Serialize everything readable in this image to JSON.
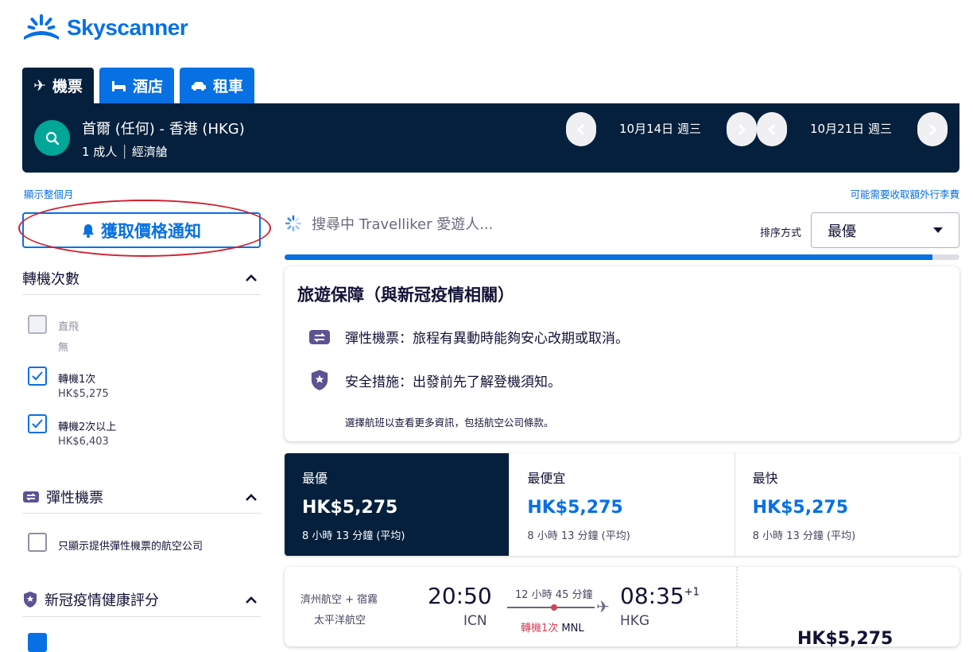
{
  "brand": {
    "name": "Skyscanner",
    "color": "#0770e3"
  },
  "tabs": [
    {
      "label": "機票",
      "icon": "plane-icon"
    },
    {
      "label": "酒店",
      "icon": "bed-icon"
    },
    {
      "label": "租車",
      "icon": "car-icon"
    }
  ],
  "search": {
    "route": "首爾 (任何) - 香港 (HKG)",
    "passengers": "1 成人",
    "cabin": "經濟艙",
    "depart_date": "10月14日 週三",
    "return_date": "10月21日 週三"
  },
  "links": {
    "show_month": "顯示整個月",
    "baggage_fees": "可能需要收取額外行李費"
  },
  "price_alert": {
    "label": "獲取價格通知"
  },
  "filters": {
    "stops": {
      "title": "轉機次數",
      "options": [
        {
          "label": "直飛",
          "sub": "無",
          "checked": false,
          "disabled": true
        },
        {
          "label": "轉機1次",
          "sub": "HK$5,275",
          "checked": true
        },
        {
          "label": "轉機2次以上",
          "sub": "HK$6,403",
          "checked": true
        }
      ]
    },
    "flexible": {
      "title": "彈性機票",
      "option": "只顯示提供彈性機票的航空公司"
    },
    "covid": {
      "title": "新冠疫情健康評分"
    }
  },
  "status": {
    "searching": "搜尋中 Travelliker 愛遊人...",
    "progress": 0.96
  },
  "sort": {
    "label": "排序方式",
    "value": "最優"
  },
  "info_card": {
    "title": "旅遊保障（與新冠疫情相關）",
    "items": [
      {
        "icon": "flexible-ticket-icon",
        "text": "彈性機票：旅程有異動時能夠安心改期或取消。"
      },
      {
        "icon": "shield-icon",
        "text": "安全措施：出發前先了解登機須知。"
      }
    ],
    "note": "選擇航班以查看更多資訊，包括航空公司條款。"
  },
  "sort_options": [
    {
      "name": "最優",
      "price": "HK$5,275",
      "duration": "8 小時 13 分鐘 (平均)",
      "active": true
    },
    {
      "name": "最便宜",
      "price": "HK$5,275",
      "duration": "8 小時 13 分鐘 (平均)",
      "active": false
    },
    {
      "name": "最快",
      "price": "HK$5,275",
      "duration": "8 小時 13 分鐘 (平均)",
      "active": false
    }
  ],
  "flight": {
    "airline_line1": "濟州航空 + 宿霧",
    "airline_line2": "太平洋航空",
    "depart_time": "20:50",
    "depart_code": "ICN",
    "duration": "12 小時 45 分鐘",
    "stops": "轉機1次",
    "via": "MNL",
    "arrive_time": "08:35",
    "day_offset": "+1",
    "arrive_code": "HKG",
    "price": "HK$5,275"
  },
  "colors": {
    "navy": "#05203c",
    "blue": "#0770e3",
    "teal": "#00a698",
    "alert_red": "#d0202e",
    "stop_red": "#d1435b"
  }
}
